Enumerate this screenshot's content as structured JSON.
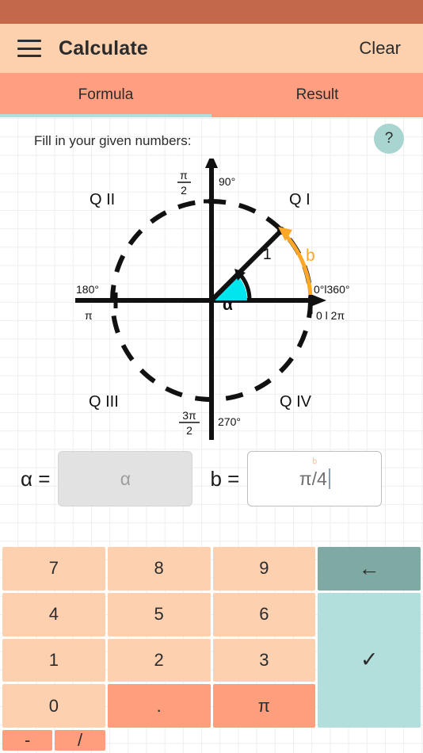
{
  "app": {
    "title": "Calculate",
    "clear_label": "Clear",
    "menu_icon": "hamburger-menu-icon"
  },
  "tabs": [
    {
      "label": "Formula",
      "active": true
    },
    {
      "label": "Result",
      "active": false
    }
  ],
  "content": {
    "instruction": "Fill in your given numbers:",
    "help_label": "?"
  },
  "diagram": {
    "type": "unit-circle",
    "radius_label": "1",
    "angle_label": "α",
    "arc_label": "b",
    "quadrants": [
      "Q I",
      "Q II",
      "Q III",
      "Q IV"
    ],
    "axis_labels": {
      "top_deg": "90°",
      "top_rad_num": "π",
      "top_rad_den": "2",
      "left_deg": "180°",
      "left_rad": "π",
      "bottom_deg": "270°",
      "bottom_rad_num": "3π",
      "bottom_rad_den": "2",
      "right_deg": "0°l360°",
      "right_rad": "0 l 2π"
    }
  },
  "inputs": {
    "alpha": {
      "label": "α =",
      "placeholder": "α",
      "value": "",
      "enabled": false
    },
    "b": {
      "label": "b =",
      "float_label": "b",
      "placeholder": "b",
      "value": "π/4",
      "enabled": true
    }
  },
  "keypad": {
    "keys": [
      {
        "label": "7",
        "name": "key-7",
        "style": "num"
      },
      {
        "label": "8",
        "name": "key-8",
        "style": "num"
      },
      {
        "label": "9",
        "name": "key-9",
        "style": "num"
      },
      {
        "label": "←",
        "name": "key-backspace",
        "style": "back"
      },
      {
        "label": "4",
        "name": "key-4",
        "style": "num"
      },
      {
        "label": "5",
        "name": "key-5",
        "style": "num"
      },
      {
        "label": "6",
        "name": "key-6",
        "style": "num"
      },
      {
        "label": "✓",
        "name": "key-confirm",
        "style": "ok"
      },
      {
        "label": "1",
        "name": "key-1",
        "style": "num"
      },
      {
        "label": "2",
        "name": "key-2",
        "style": "num"
      },
      {
        "label": "3",
        "name": "key-3",
        "style": "num"
      },
      {
        "label": "0",
        "name": "key-0",
        "style": "num"
      },
      {
        "label": ".",
        "name": "key-decimal",
        "style": "op"
      },
      {
        "label": "π",
        "name": "key-pi",
        "style": "op"
      },
      {
        "label": "-",
        "name": "key-minus",
        "style": "op"
      },
      {
        "label": "/",
        "name": "key-divide",
        "style": "op"
      }
    ]
  },
  "colors": {
    "status_bar": "#c4684b",
    "app_bar": "#fdd0ae",
    "tab_bar": "#ff9e80",
    "tab_indicator": "#b2dfdb",
    "key_number": "#fdd0b0",
    "key_operator": "#ff9e7d",
    "key_backspace": "#7faaa3",
    "key_confirm": "#b2dfdb",
    "angle_fill": "#00e5ee",
    "arc_orange": "#ffa726",
    "help_button": "#a8d5d0"
  }
}
